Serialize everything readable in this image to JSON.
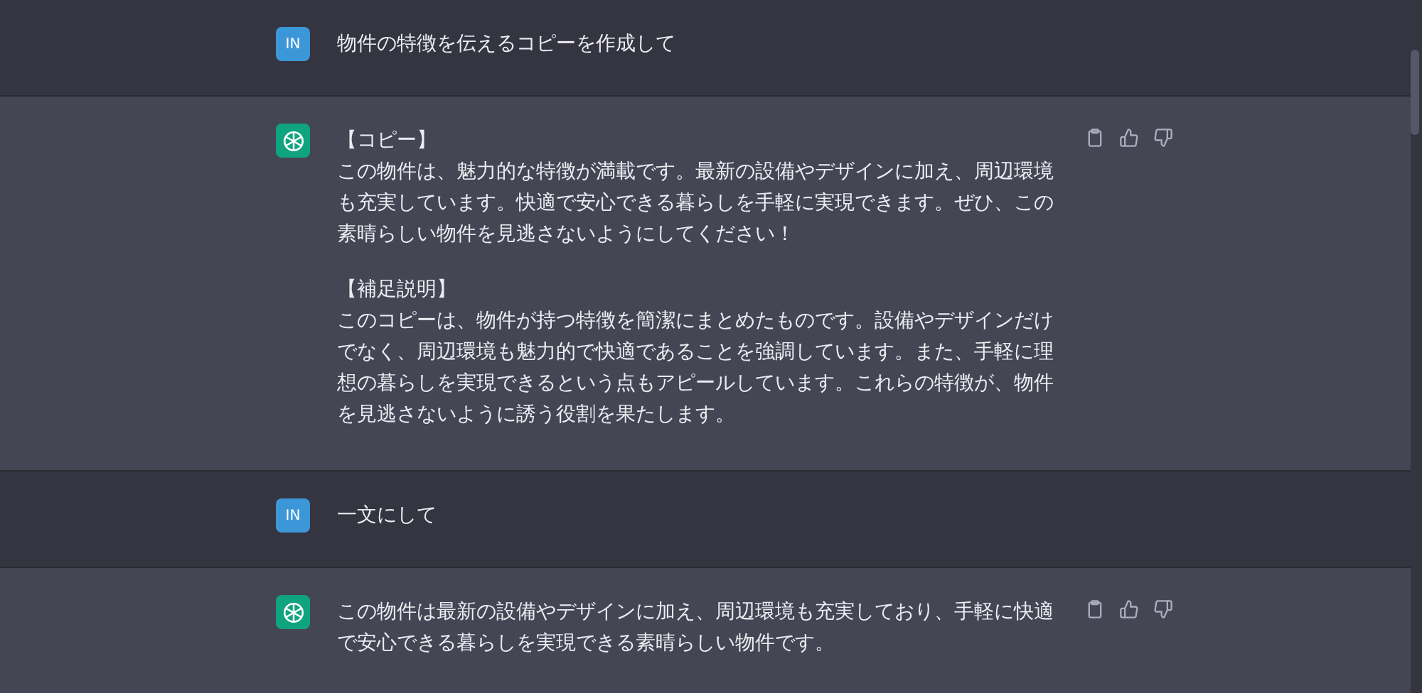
{
  "messages": [
    {
      "kind": "user",
      "avatar": "IN",
      "paragraphs": [
        [
          "物件の特徴を伝えるコピーを作成して"
        ]
      ]
    },
    {
      "kind": "assistant",
      "paragraphs": [
        [
          "【コピー】",
          "この物件は、魅力的な特徴が満載です。最新の設備やデザインに加え、周辺環境も充実しています。快適で安心できる暮らしを手軽に実現できます。ぜひ、この素晴らしい物件を見逃さないようにしてください！"
        ],
        [
          "【補足説明】",
          "このコピーは、物件が持つ特徴を簡潔にまとめたものです。設備やデザインだけでなく、周辺環境も魅力的で快適であることを強調しています。また、手軽に理想の暮らしを実現できるという点もアピールしています。これらの特徴が、物件を見逃さないように誘う役割を果たします。"
        ]
      ]
    },
    {
      "kind": "user",
      "avatar": "IN",
      "paragraphs": [
        [
          "一文にして"
        ]
      ]
    },
    {
      "kind": "assistant",
      "paragraphs": [
        [
          "この物件は最新の設備やデザインに加え、周辺環境も充実しており、手軽に快適で安心できる暮らしを実現できる素晴らしい物件です。"
        ]
      ]
    }
  ]
}
